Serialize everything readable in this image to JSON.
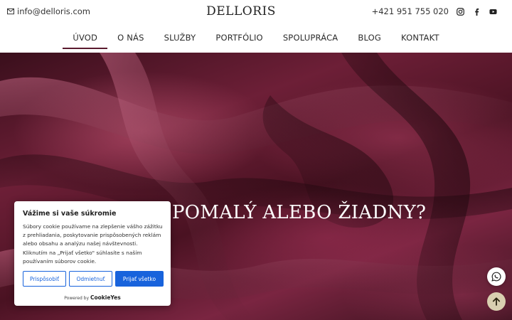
{
  "header": {
    "email": "info@delloris.com",
    "logo": "DELLORIS",
    "phone": "+421 951 755 020",
    "social_icons": [
      "instagram-icon",
      "facebook-icon",
      "youtube-icon"
    ]
  },
  "nav": {
    "items": [
      {
        "label": "ÚVOD",
        "active": true
      },
      {
        "label": "O NÁS",
        "active": false
      },
      {
        "label": "SLUŽBY",
        "active": false
      },
      {
        "label": "PORTFÓLIO",
        "active": false
      },
      {
        "label": "SPOLUPRÁCA",
        "active": false
      },
      {
        "label": "BLOG",
        "active": false
      },
      {
        "label": "KONTAKT",
        "active": false
      }
    ]
  },
  "hero": {
    "title": "POMALÝ ALEBO ŽIADNY?"
  },
  "cookie": {
    "title": "Vážime si vaše súkromie",
    "text": "Súbory cookie používame na zlepšenie vášho zážitku z prehliadania, poskytovanie prispôsobených reklám alebo obsahu a analýzu našej návštevnosti. Kliknutím na „Prijať všetko\" súhlasíte s naším používaním súborov cookie.",
    "buttons": {
      "customize": "Prispôsobiť",
      "reject": "Odmietnuť",
      "accept": "Prijať všetko"
    },
    "powered_by": "Powered by",
    "brand": "CookieYes"
  },
  "colors": {
    "accent": "#5a1a2e",
    "cookie_blue": "#1863dc",
    "scroll_top_bg": "#d9cfb0"
  }
}
